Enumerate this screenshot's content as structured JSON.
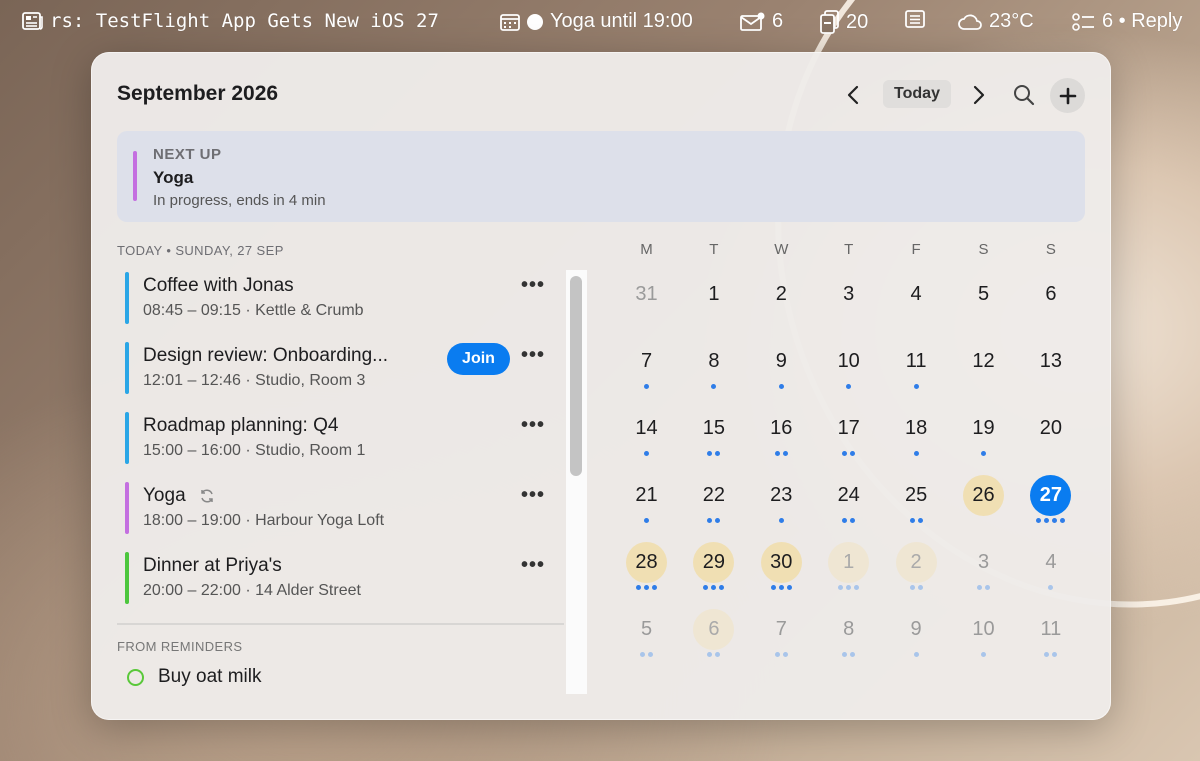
{
  "menubar": {
    "news": "rs: TestFlight App Gets New iOS 27",
    "event": "Yoga until 19:00",
    "mail_count": "6",
    "clip_count": "20",
    "weather": "23°C",
    "reply": "6 • Reply"
  },
  "header": {
    "month": "September 2026",
    "today_label": "Today"
  },
  "next_up": {
    "label": "NEXT UP",
    "title": "Yoga",
    "subtitle": "In progress, ends in 4 min",
    "color": "#c46fe0"
  },
  "today_header": "TODAY • SUNDAY, 27 SEP",
  "events": [
    {
      "title": "Coffee with Jonas",
      "subtitle": "08:45 – 09:15 · Kettle & Crumb",
      "color": "#2aa6e6"
    },
    {
      "title": "Design review: Onboarding...",
      "subtitle": "12:01 – 12:46 · Studio, Room 3",
      "color": "#2aa6e6",
      "join": "Join"
    },
    {
      "title": "Roadmap planning: Q4",
      "subtitle": "15:00 – 16:00 · Studio, Room 1",
      "color": "#2aa6e6"
    },
    {
      "title": "Yoga",
      "subtitle": "18:00 – 19:00 · Harbour Yoga Loft",
      "color": "#c46fe0",
      "recurring": true
    },
    {
      "title": "Dinner at Priya's",
      "subtitle": "20:00 – 22:00 · 14 Alder Street",
      "color": "#4cc63d"
    }
  ],
  "reminders": {
    "header": "FROM REMINDERS",
    "items": [
      "Buy oat milk"
    ]
  },
  "calendar": {
    "weekdays": [
      "M",
      "T",
      "W",
      "T",
      "F",
      "S",
      "S"
    ],
    "weeks": [
      [
        {
          "d": "31",
          "m": true,
          "dots": 0
        },
        {
          "d": "1",
          "dots": 0
        },
        {
          "d": "2",
          "dots": 0
        },
        {
          "d": "3",
          "dots": 0
        },
        {
          "d": "4",
          "dots": 0
        },
        {
          "d": "5",
          "dots": 0
        },
        {
          "d": "6",
          "dots": 0
        }
      ],
      [
        {
          "d": "7",
          "dots": 1
        },
        {
          "d": "8",
          "dots": 1
        },
        {
          "d": "9",
          "dots": 1
        },
        {
          "d": "10",
          "dots": 1
        },
        {
          "d": "11",
          "dots": 1
        },
        {
          "d": "12",
          "dots": 0
        },
        {
          "d": "13",
          "dots": 0
        }
      ],
      [
        {
          "d": "14",
          "dots": 1
        },
        {
          "d": "15",
          "dots": 2
        },
        {
          "d": "16",
          "dots": 2
        },
        {
          "d": "17",
          "dots": 2
        },
        {
          "d": "18",
          "dots": 1
        },
        {
          "d": "19",
          "dots": 1
        },
        {
          "d": "20",
          "dots": 0
        }
      ],
      [
        {
          "d": "21",
          "dots": 1
        },
        {
          "d": "22",
          "dots": 2
        },
        {
          "d": "23",
          "dots": 1
        },
        {
          "d": "24",
          "dots": 2
        },
        {
          "d": "25",
          "dots": 2
        },
        {
          "d": "26",
          "dots": 0,
          "hl": true
        },
        {
          "d": "27",
          "dots": 4,
          "sel": true
        }
      ],
      [
        {
          "d": "28",
          "dots": 3,
          "hl": true
        },
        {
          "d": "29",
          "dots": 3,
          "hl": true
        },
        {
          "d": "30",
          "dots": 3,
          "hl": true
        },
        {
          "d": "1",
          "m": true,
          "dots": 3,
          "hl": true
        },
        {
          "d": "2",
          "m": true,
          "dots": 2,
          "hl": true
        },
        {
          "d": "3",
          "m": true,
          "dots": 2
        },
        {
          "d": "4",
          "m": true,
          "dots": 1
        }
      ],
      [
        {
          "d": "5",
          "m": true,
          "dots": 2
        },
        {
          "d": "6",
          "m": true,
          "dots": 2,
          "hl": true
        },
        {
          "d": "7",
          "m": true,
          "dots": 2
        },
        {
          "d": "8",
          "m": true,
          "dots": 2
        },
        {
          "d": "9",
          "m": true,
          "dots": 1
        },
        {
          "d": "10",
          "m": true,
          "dots": 1
        },
        {
          "d": "11",
          "m": true,
          "dots": 2
        }
      ]
    ]
  },
  "colors": {
    "accent": "#0a7cf0",
    "highlight": "#f0dfb3",
    "dot": "#2f7de8"
  }
}
